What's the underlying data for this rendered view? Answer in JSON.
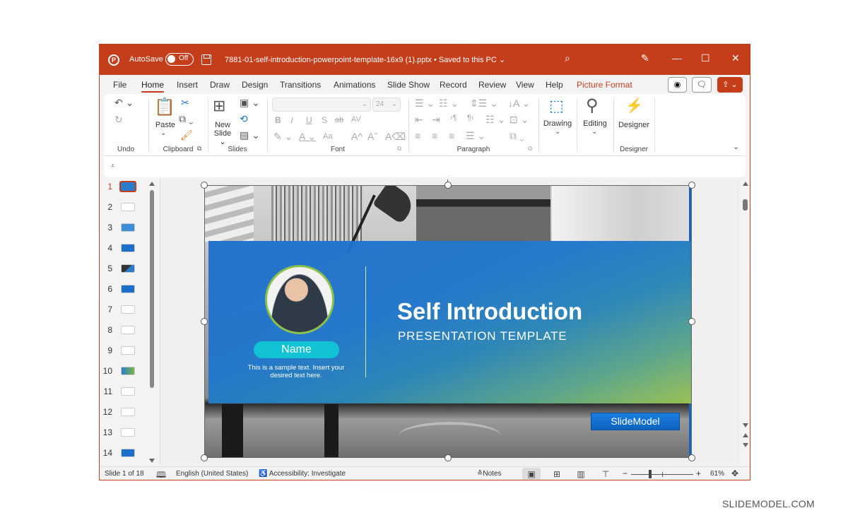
{
  "titlebar": {
    "app_icon": "powerpoint-logo-icon",
    "autosave_label": "AutoSave",
    "autosave_state": "Off",
    "filename": "7881-01-self-introduction-powerpoint-template-16x9 (1).pptx",
    "save_status": "Saved to this PC",
    "icons": [
      "search-icon",
      "designer-pen-icon",
      "minimize-icon",
      "maximize-icon",
      "close-icon"
    ]
  },
  "tabs": [
    {
      "label": "File"
    },
    {
      "label": "Home",
      "active": true
    },
    {
      "label": "Insert"
    },
    {
      "label": "Draw"
    },
    {
      "label": "Design"
    },
    {
      "label": "Transitions"
    },
    {
      "label": "Animations"
    },
    {
      "label": "Slide Show"
    },
    {
      "label": "Record"
    },
    {
      "label": "Review"
    },
    {
      "label": "View"
    },
    {
      "label": "Help"
    },
    {
      "label": "Picture Format",
      "contextual": true
    }
  ],
  "tab_buttons": {
    "record": "◉",
    "comments": "🗨",
    "share": "⇪ ⌄"
  },
  "ribbon": {
    "undo": {
      "group": "Undo"
    },
    "clipboard": {
      "group": "Clipboard",
      "paste": "Paste"
    },
    "slides": {
      "group": "Slides",
      "new_slide_1": "New",
      "new_slide_2": "Slide"
    },
    "font": {
      "group": "Font",
      "font_name": "",
      "font_size": "24",
      "bold": "B",
      "italic": "I",
      "underline": "U",
      "shadow": "S",
      "strike": "ab",
      "spacing": "AV",
      "case": "Aa",
      "grow": "A^",
      "shrink": "Aˇ"
    },
    "paragraph": {
      "group": "Paragraph"
    },
    "drawing": {
      "label": "Drawing"
    },
    "editing": {
      "label": "Editing"
    },
    "designer": {
      "label": "Designer",
      "group": "Designer"
    }
  },
  "slides_panel": {
    "active": 1,
    "items": [
      "1",
      "2",
      "3",
      "4",
      "5",
      "6",
      "7",
      "8",
      "9",
      "10",
      "11",
      "12",
      "13",
      "14"
    ]
  },
  "slide": {
    "title": "Self Introduction",
    "subtitle": "PRESENTATION TEMPLATE",
    "name_label": "Name",
    "sample_text": "This is a sample text. Insert your desired text here.",
    "brand": "SlideModel",
    "colors": {
      "band_start": "#1f6fce",
      "band_end": "#9cc452",
      "pill": "#12c3d6",
      "ring": "#8bc34a"
    }
  },
  "statusbar": {
    "slide_counter": "Slide 1 of 18",
    "language": "English (United States)",
    "accessibility": "Accessibility: Investigate",
    "notes": "Notes",
    "zoom_minus": "−",
    "zoom_plus": "+",
    "zoom_level": "61%"
  },
  "watermark": "SLIDEMODEL.COM",
  "accent_color": "#c43e1c"
}
